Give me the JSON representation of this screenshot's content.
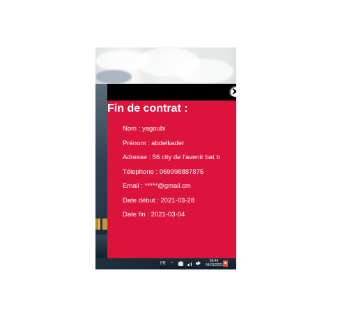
{
  "modal": {
    "title": "Fin de contrat :",
    "close_icon": "✕",
    "details": {
      "nom": "Nom : yagoubi",
      "prenom": "Prénom : abdelkader",
      "adresse": "Adresse : 56 city de l'avenir bat b",
      "telephone": "Télephone : 069998887875",
      "email": "Email : *****@gmail.cm",
      "date_debut": "Date début : 2021-03-28",
      "date_fin": "Date fin : 2021-03-04"
    }
  },
  "taskbar": {
    "language": "FR",
    "overflow_icon": "^",
    "time": "20:49",
    "date": "04/03/2021"
  },
  "colors": {
    "modal_background": "#dc143c",
    "modal_header": "#000000",
    "text": "#ffffff"
  },
  "icons": {
    "close": "close-icon",
    "overflow": "chevron-up-icon",
    "network": "network-icon",
    "signal": "signal-icon",
    "speaker": "speaker-icon",
    "notification": "notification-icon"
  }
}
